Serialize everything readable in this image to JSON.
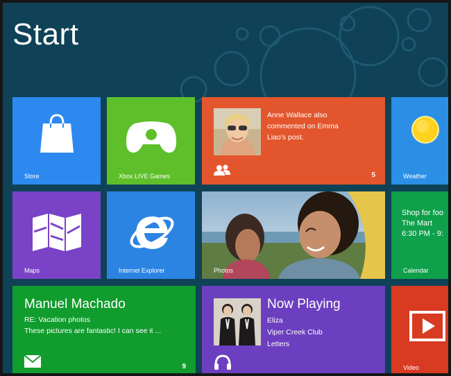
{
  "start_title": "Start",
  "colors": {
    "background": "#0f4257",
    "store": "#2d89ef",
    "xbox": "#5ebf2a",
    "people": "#e3562d",
    "weather": "#2b8fe6",
    "maps": "#7a43c7",
    "ie": "#2b84e2",
    "calendar": "#0fa04b",
    "mail": "#119c2e",
    "music": "#6b3fbf",
    "video": "#d83a22"
  },
  "tiles": {
    "store": {
      "label": "Store",
      "icon": "shopping-bag-icon"
    },
    "xbox": {
      "label": "Xbox LIVE Games",
      "icon": "game-controller-icon"
    },
    "people": {
      "message_lines": [
        "Anne Wallace also",
        "commented on Emma",
        "Liao's post."
      ],
      "badge": "5",
      "icon": "people-icon"
    },
    "weather": {
      "label": "Weather",
      "icon": "sun-icon"
    },
    "maps": {
      "label": "Maps",
      "icon": "map-icon"
    },
    "ie": {
      "label": "Internet Explorer",
      "icon": "ie-logo-icon"
    },
    "photos": {
      "label": "Photos"
    },
    "calendar": {
      "lines": [
        "Shop for foo",
        "The Mart",
        "6:30 PM - 9:"
      ],
      "label": "Calendar"
    },
    "mail": {
      "sender": "Manuel Machado",
      "subject": "RE: Vacation photos",
      "preview": "These pictures are fantastic! I can see it ...",
      "badge": "9",
      "icon": "envelope-icon"
    },
    "music": {
      "title": "Now Playing",
      "track": "Eliza",
      "artist": "Viper Creek Club",
      "album": "Letters",
      "icon": "headphones-icon"
    },
    "video": {
      "label": "Video",
      "icon": "play-icon"
    }
  }
}
